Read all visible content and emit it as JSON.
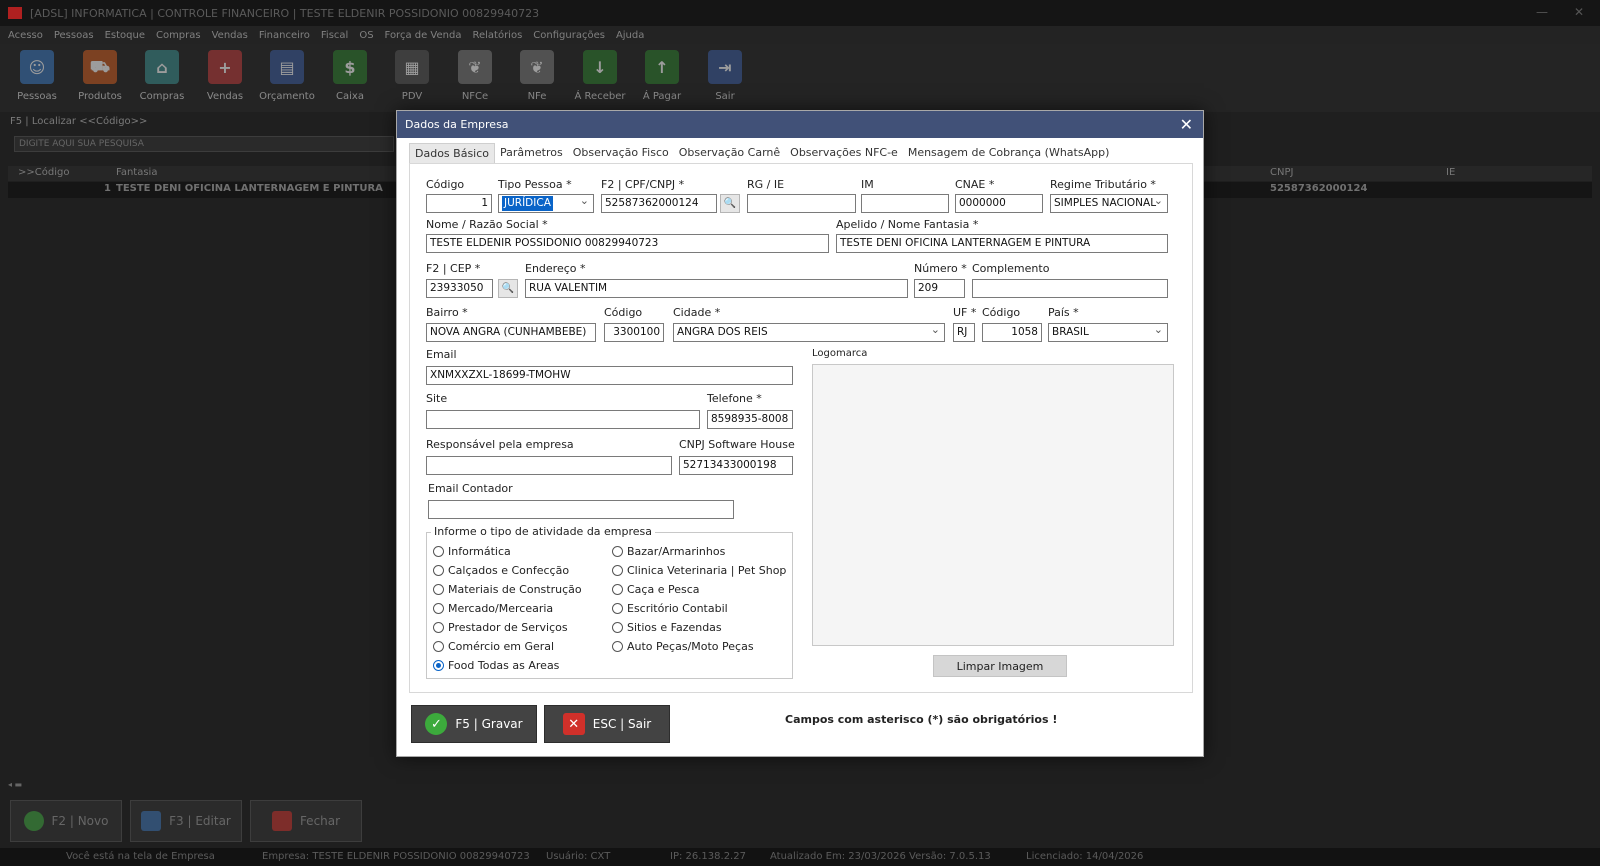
{
  "window": {
    "title": "[ADSL] INFORMATICA | CONTROLE FINANCEIRO | TESTE ELDENIR POSSIDONIO 00829940723"
  },
  "menu": [
    "Acesso",
    "Pessoas",
    "Estoque",
    "Compras",
    "Vendas",
    "Financeiro",
    "Fiscal",
    "OS",
    "Força de Venda",
    "Relatórios",
    "Configurações",
    "Ajuda"
  ],
  "toolbar": [
    {
      "label": "Pessoas",
      "icon": "people-icon",
      "color": "#3a74b8"
    },
    {
      "label": "Produtos",
      "icon": "cart-icon",
      "color": "#c45a22"
    },
    {
      "label": "Compras",
      "icon": "store-icon",
      "color": "#3a8a8a"
    },
    {
      "label": "Vendas",
      "icon": "basket-icon",
      "color": "#b83a3a"
    },
    {
      "label": "Orçamento",
      "icon": "document-icon",
      "color": "#3a5a9a"
    },
    {
      "label": "Caixa",
      "icon": "money-house-icon",
      "color": "#2e7a2e"
    },
    {
      "label": "PDV",
      "icon": "pos-terminal-icon",
      "color": "#555555"
    },
    {
      "label": "NFCe",
      "icon": "leaf-icon",
      "color": "#777777"
    },
    {
      "label": "NFe",
      "icon": "leaf-icon",
      "color": "#777777"
    },
    {
      "label": "Á Receber",
      "icon": "cash-in-icon",
      "color": "#2e7a2e"
    },
    {
      "label": "Á Pagar",
      "icon": "cash-out-icon",
      "color": "#2e7a2e"
    },
    {
      "label": "Sair",
      "icon": "exit-icon",
      "color": "#3a5a9a"
    }
  ],
  "search": {
    "label": "F5 | Localizar <<Código>>",
    "placeholder": "DIGITE AQUI SUA PESQUISA"
  },
  "grid": {
    "headers": {
      "codigo": ">>Código",
      "fantasia": "Fantasia",
      "cnpj": "CNPJ",
      "ie": "IE"
    },
    "row": {
      "codigo": "1",
      "fantasia": "TESTE DENI OFICINA LANTERNAGEM E PINTURA",
      "cnpj": "52587362000124"
    }
  },
  "bottom_buttons": {
    "novo": "F2 | Novo",
    "editar": "F3 | Editar",
    "fechar": "Fechar"
  },
  "status": {
    "tela": "Você está na tela de Empresa",
    "empresa": "Empresa: TESTE ELDENIR POSSIDONIO 00829940723",
    "usuario": "Usuário: CXT",
    "ip": "IP: 26.138.2.27",
    "atualizado": "Atualizado Em: 23/03/2026  Versão: 7.0.5.13",
    "licenciado": "Licenciado: 14/04/2026"
  },
  "dialog": {
    "title": "Dados da Empresa",
    "tabs": [
      "Dados Básico",
      "Parâmetros",
      "Observação Fisco",
      "Observação Carnê",
      "Observações NFC-e",
      "Mensagem de Cobrança (WhatsApp)"
    ],
    "fields": {
      "codigo": {
        "label": "Código",
        "value": "1"
      },
      "tipo_pessoa": {
        "label": "Tipo Pessoa *",
        "value": "JURÍDICA"
      },
      "cpf_cnpj": {
        "label": "F2 | CPF/CNPJ *",
        "value": "52587362000124"
      },
      "rg_ie": {
        "label": "RG / IE",
        "value": ""
      },
      "im": {
        "label": "IM",
        "value": ""
      },
      "cnae": {
        "label": "CNAE *",
        "value": "0000000"
      },
      "regime": {
        "label": "Regime Tributário *",
        "value": "SIMPLES NACIONAL"
      },
      "razao_social": {
        "label": "Nome / Razão Social *",
        "value": "TESTE ELDENIR POSSIDONIO 00829940723"
      },
      "fantasia": {
        "label": "Apelido / Nome Fantasia *",
        "value": "TESTE DENI OFICINA LANTERNAGEM E PINTURA"
      },
      "cep": {
        "label": "F2 | CEP *",
        "value": "23933050"
      },
      "endereco": {
        "label": "Endereço *",
        "value": "RUA VALENTIM"
      },
      "numero": {
        "label": "Número *",
        "value": "209"
      },
      "complemento": {
        "label": "Complemento",
        "value": ""
      },
      "bairro": {
        "label": "Bairro *",
        "value": "NOVA ANGRA (CUNHAMBEBE)"
      },
      "codigo_cidade": {
        "label": "Código",
        "value": "3300100"
      },
      "cidade": {
        "label": "Cidade *",
        "value": "ANGRA DOS REIS"
      },
      "uf": {
        "label": "UF *",
        "value": "RJ"
      },
      "codigo_pais": {
        "label": "Código",
        "value": "1058"
      },
      "pais": {
        "label": "País *",
        "value": "BRASIL"
      },
      "email": {
        "label": "Email",
        "value": "XNMXXZXL-18699-TMOHW"
      },
      "site": {
        "label": "Site",
        "value": ""
      },
      "telefone": {
        "label": "Telefone *",
        "value": "8598935-8008"
      },
      "responsavel": {
        "label": "Responsável pela empresa",
        "value": ""
      },
      "cnpj_software": {
        "label": "CNPJ Software House",
        "value": "52713433000198"
      },
      "email_contador": {
        "label": "Email Contador",
        "value": ""
      }
    },
    "logomarca_label": "Logomarca",
    "limpar_label": "Limpar Imagem",
    "atividade": {
      "title": "Informe o tipo de atividade da empresa",
      "left": [
        "Informática",
        "Calçados e Confecção",
        "Materiais de Construção",
        "Mercado/Mercearia",
        "Prestador de Serviços",
        "Comércio em Geral",
        "Food Todas as Areas"
      ],
      "right": [
        "Bazar/Armarinhos",
        "Clinica Veterinaria | Pet Shop",
        "Caça e Pesca",
        "Escritório Contabil",
        "Sitios e Fazendas",
        "Auto Peças/Moto Peças"
      ],
      "selected": "Food Todas as Areas"
    },
    "gravar_label": "F5 | Gravar",
    "sair_label": "ESC | Sair",
    "required_note": "Campos com asterisco (*) são obrigatórios !"
  }
}
